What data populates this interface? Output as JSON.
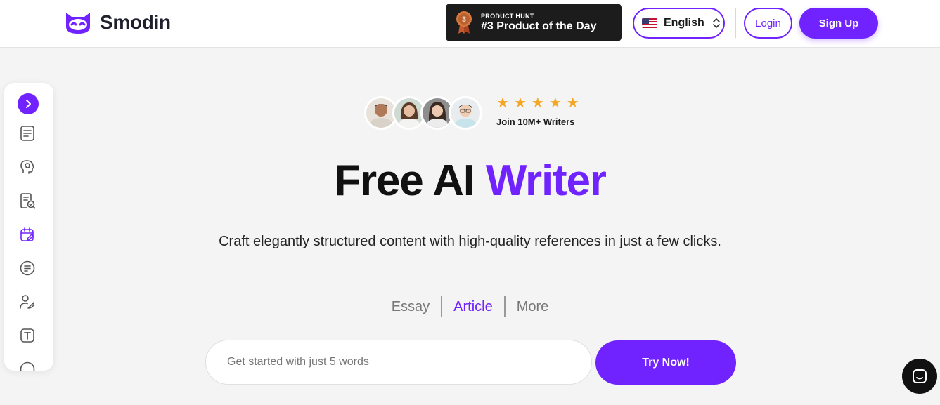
{
  "header": {
    "brand": "Smodin",
    "product_hunt": {
      "rank": "3",
      "label_small": "PRODUCT HUNT",
      "label_big": "#3 Product of the Day"
    },
    "language": {
      "label": "English",
      "flag": "us-flag-icon"
    },
    "login_label": "Login",
    "signup_label": "Sign Up"
  },
  "sidebar": {
    "items": [
      {
        "name": "expand-icon"
      },
      {
        "name": "document-lines-icon"
      },
      {
        "name": "brain-icon"
      },
      {
        "name": "document-check-icon"
      },
      {
        "name": "calendar-edit-icon"
      },
      {
        "name": "summary-circle-icon"
      },
      {
        "name": "user-pen-icon"
      },
      {
        "name": "text-box-icon"
      }
    ]
  },
  "hero": {
    "rating_stars": 5,
    "join_text": "Join 10M+ Writers",
    "title_part1": "Free AI ",
    "title_part2": "Writer",
    "subtitle": "Craft elegantly structured content with high-quality references in just a few clicks.",
    "tabs": [
      {
        "label": "Essay",
        "active": false
      },
      {
        "label": "Article",
        "active": true
      },
      {
        "label": "More",
        "active": false
      }
    ],
    "input_placeholder": "Get started with just 5 words",
    "cta_label": "Try Now!"
  },
  "colors": {
    "accent": "#7022ff",
    "star": "#f5a623",
    "badge_bg": "#1c1c1c"
  }
}
